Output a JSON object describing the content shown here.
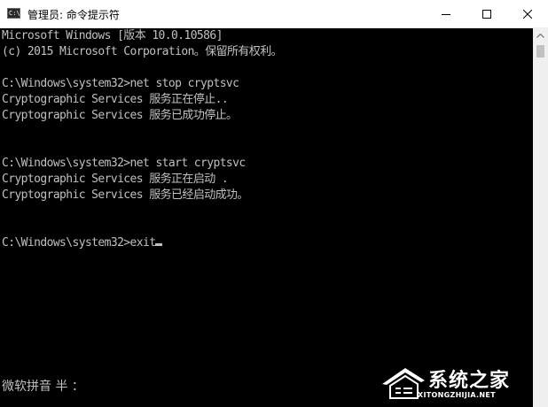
{
  "window": {
    "title": "管理员: 命令提示符",
    "app_icon_text": "C:\\",
    "controls": {
      "minimize_icon": "minimize-icon",
      "maximize_icon": "maximize-icon",
      "close_icon": "close-icon"
    }
  },
  "console": {
    "lines": [
      "Microsoft Windows [版本 10.0.10586]",
      "(c) 2015 Microsoft Corporation。保留所有权利。",
      "",
      "C:\\Windows\\system32>net stop cryptsvc",
      "Cryptographic Services 服务正在停止..",
      "Cryptographic Services 服务已成功停止。",
      "",
      "",
      "C:\\Windows\\system32>net start cryptsvc",
      "Cryptographic Services 服务正在启动 .",
      "Cryptographic Services 服务已经启动成功。",
      "",
      "",
      "C:\\Windows\\system32>exit"
    ],
    "text_color": "#c0c0c0",
    "background_color": "#000000",
    "ime_status": "微软拼音 半 ："
  },
  "watermark": {
    "title": "系统之家",
    "subtitle": "XITONGZHIJIA.NET"
  }
}
